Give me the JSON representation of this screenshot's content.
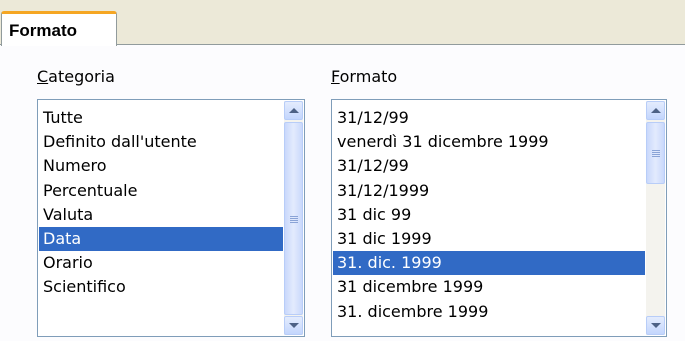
{
  "tab": {
    "label": "Formato"
  },
  "categoria": {
    "label_accel": "C",
    "label_rest": "ategoria",
    "items": [
      "Tutte",
      "Definito dall'utente",
      "Numero",
      "Percentuale",
      "Valuta",
      "Data",
      "Orario",
      "Scientifico"
    ],
    "selected": "Data"
  },
  "formato": {
    "label_accel": "F",
    "label_rest": "ormato",
    "items": [
      "31/12/99",
      "venerdì 31 dicembre 1999",
      "31/12/99",
      "31/12/1999",
      "31 dic 99",
      "31 dic 1999",
      "31. dic. 1999",
      "31 dicembre 1999",
      "31. dicembre 1999"
    ],
    "selected": "31. dic. 1999"
  },
  "colors": {
    "selection": "#316ac5",
    "tab_accent": "#f5a623",
    "list_border": "#7f9db9"
  }
}
